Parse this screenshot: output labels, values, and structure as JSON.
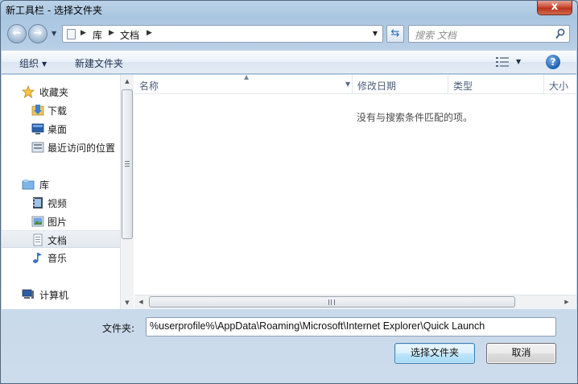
{
  "window": {
    "title": "新工具栏 - 选择文件夹",
    "close_glyph": "x"
  },
  "navigation": {
    "back_glyph": "←",
    "forward_glyph": "→",
    "address": {
      "segments": [
        "库",
        "文档"
      ]
    },
    "search": {
      "placeholder": "搜索 文档"
    }
  },
  "toolbar": {
    "organize_label": "组织",
    "new_folder_label": "新建文件夹",
    "help_glyph": "?"
  },
  "sidebar": {
    "favorites": {
      "label": "收藏夹",
      "items": [
        {
          "label": "下载",
          "icon": "download-folder-icon"
        },
        {
          "label": "桌面",
          "icon": "desktop-icon"
        },
        {
          "label": "最近访问的位置",
          "icon": "recent-places-icon"
        }
      ]
    },
    "libraries": {
      "label": "库",
      "items": [
        {
          "label": "视频",
          "icon": "video-library-icon"
        },
        {
          "label": "图片",
          "icon": "pictures-library-icon"
        },
        {
          "label": "文档",
          "icon": "documents-library-icon",
          "selected": true
        },
        {
          "label": "音乐",
          "icon": "music-library-icon"
        }
      ]
    },
    "computer": {
      "label": "计算机"
    }
  },
  "file_list": {
    "columns": [
      "名称",
      "修改日期",
      "类型",
      "大小"
    ],
    "empty_message": "没有与搜索条件匹配的项。"
  },
  "footer": {
    "folder_label": "文件夹:",
    "folder_value": "%userprofile%\\AppData\\Roaming\\Microsoft\\Internet Explorer\\Quick Launch",
    "select_button": "选择文件夹",
    "cancel_button": "取消"
  },
  "colors": {
    "window_frame": "#a9c6e1",
    "selection": "#e3e8ee",
    "column_text": "#4c607a",
    "primary_button_border": "#3c7fb1"
  }
}
